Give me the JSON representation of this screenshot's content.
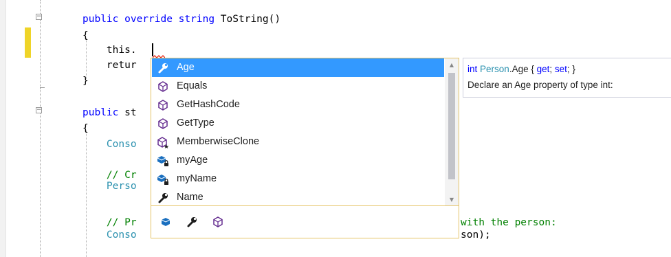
{
  "code": {
    "lines": [
      {
        "pre": "",
        "kw": "public override string",
        "post": " ToString()"
      },
      {
        "text": "{"
      },
      {
        "text": "    this."
      },
      {
        "text": "    retur"
      },
      {
        "text": "}"
      },
      {
        "kw": "public",
        "post": " st"
      },
      {
        "text": "{"
      },
      {
        "text": "    Conso"
      },
      {
        "comment": "    // Cr"
      },
      {
        "cls": "    Perso"
      },
      {
        "comment": "    // Pr",
        "tail": "with the person:"
      },
      {
        "text": "    Conso",
        "tail": "son);"
      }
    ]
  },
  "completion": {
    "items": [
      {
        "label": "Age",
        "icon": "wrench-property-icon",
        "selected": true
      },
      {
        "label": "Equals",
        "icon": "method-cube-icon",
        "selected": false
      },
      {
        "label": "GetHashCode",
        "icon": "method-cube-icon",
        "selected": false
      },
      {
        "label": "GetType",
        "icon": "method-cube-icon",
        "selected": false
      },
      {
        "label": "MemberwiseClone",
        "icon": "protected-method-cube-icon",
        "selected": false
      },
      {
        "label": "myAge",
        "icon": "private-field-icon",
        "selected": false
      },
      {
        "label": "myName",
        "icon": "private-field-icon",
        "selected": false
      },
      {
        "label": "Name",
        "icon": "wrench-property-icon",
        "selected": false
      }
    ],
    "filters": [
      {
        "name": "field-filter-icon"
      },
      {
        "name": "property-filter-icon"
      },
      {
        "name": "method-filter-icon"
      }
    ]
  },
  "tooltip": {
    "line1_type": "int",
    "line1_class": "Person",
    "line1_member": ".Age { ",
    "line1_get": "get",
    "line1_sep": "; ",
    "line1_set": "set",
    "line1_end": "; }",
    "line2": "Declare an Age property of type int:"
  },
  "colors": {
    "keyword": "#0000ff",
    "type": "#2b91af",
    "comment": "#008000",
    "selection": "#3399ff",
    "change_bar": "#efd428",
    "popup_border": "#e5c365"
  }
}
